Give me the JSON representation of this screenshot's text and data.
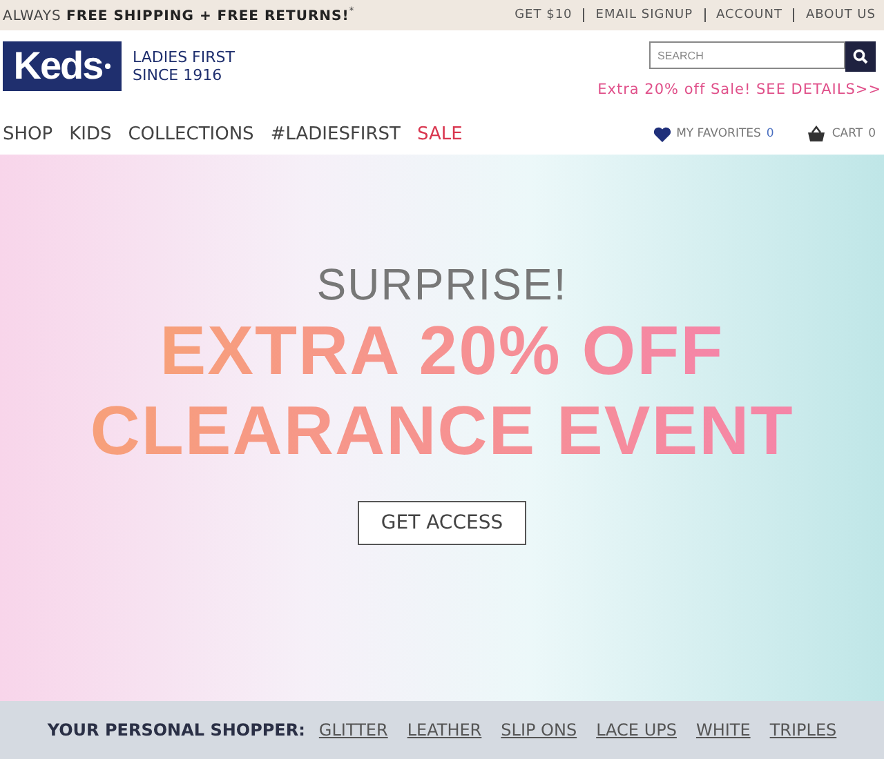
{
  "top_bar": {
    "promo": "ALWAYS **FREE SHIPPING + FREE RETURNS!**$^{*}$",
    "links": [
      "GET $10",
      "EMAIL SIGNUP",
      "ACCOUNT",
      "ABOUT US"
    ]
  },
  "header": {
    "logo": "Keds",
    "tagline": [
      "LADIES FIRST",
      "SINCE 1916"
    ],
    "search": {
      "placeholder": "SEARCH"
    },
    "sale_notice": "Extra 20% off Sale! SEE DETAILS>>"
  },
  "nav": [
    {
      "label": "SHOP",
      "highlight": false
    },
    {
      "label": "KIDS",
      "highlight": false
    },
    {
      "label": "COLLECTIONS",
      "highlight": false
    },
    {
      "label": "#LADIESFIRST",
      "highlight": false
    },
    {
      "label": "SALE",
      "highlight": true
    }
  ],
  "favorites": {
    "label": "MY FAVORITES",
    "count": "0"
  },
  "cart": {
    "label": "CART",
    "count": "0"
  },
  "hero": {
    "kicker": "SURPRISE!",
    "headline": [
      "EXTRA 20% OFF",
      "CLEARANCE EVENT"
    ],
    "button": "GET ACCESS"
  },
  "shopper": {
    "label": "YOUR PERSONAL SHOPPER:",
    "links": [
      "GLITTER",
      "LEATHER",
      "SLIP ONS",
      "LACE UPS",
      "WHITE",
      "TRIPLES"
    ]
  }
}
